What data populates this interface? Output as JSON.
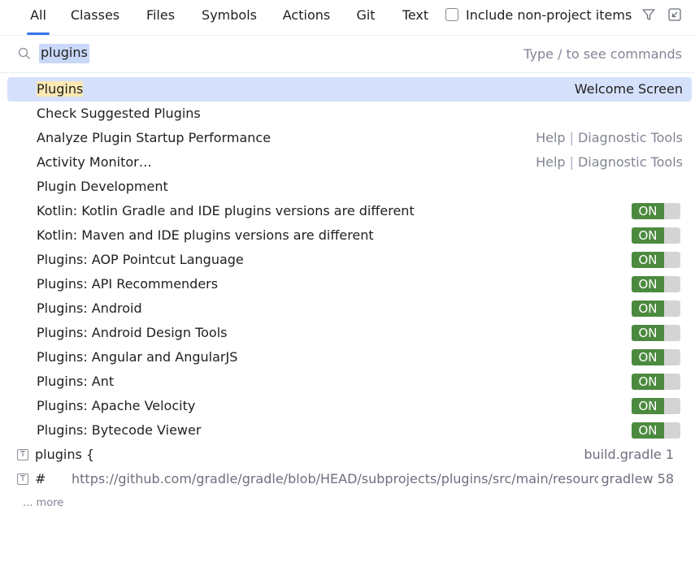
{
  "tabs": [
    {
      "label": "All",
      "active": true
    },
    {
      "label": "Classes"
    },
    {
      "label": "Files"
    },
    {
      "label": "Symbols"
    },
    {
      "label": "Actions"
    },
    {
      "label": "Git"
    },
    {
      "label": "Text"
    }
  ],
  "include_non_project": {
    "label": "Include non-project items",
    "checked": false
  },
  "header_icons": [
    "filter-icon",
    "collapse-to-panel-icon"
  ],
  "search": {
    "value": "plugins",
    "hint": "Type / to see commands"
  },
  "results": [
    {
      "pre": "",
      "hl": "Plugins",
      "post": "",
      "right": "Welcome Screen",
      "selected": true
    },
    {
      "pre": "Check Suggested Plugins"
    },
    {
      "pre": "Analyze Plugin Startup Performance",
      "right_a": "Help",
      "right_b": "Diagnostic Tools"
    },
    {
      "pre": "Activity Monitor…",
      "right_a": "Help",
      "right_b": "Diagnostic Tools"
    },
    {
      "pre": "Plugin Development"
    }
  ],
  "toggle_label": "ON",
  "toggle_results": [
    "Kotlin: Kotlin Gradle and IDE plugins versions are different",
    "Kotlin: Maven and IDE plugins versions are different",
    "Plugins: AOP Pointcut Language",
    "Plugins: API Recommenders",
    "Plugins: Android",
    "Plugins: Android Design Tools",
    "Plugins: Angular and AngularJS",
    "Plugins: Ant",
    "Plugins: Apache Velocity",
    "Plugins: Bytecode Viewer"
  ],
  "text_results": [
    {
      "icon": "T",
      "name": "plugins {",
      "url": "",
      "right": "build.gradle 1"
    },
    {
      "icon": "T",
      "name": "#",
      "url": "https://github.com/gradle/gradle/blob/HEAD/subprojects/plugins/src/main/resource",
      "right": "gradlew 58"
    }
  ],
  "more_label": "... more",
  "colors": {
    "accent": "#3574f0",
    "selection": "#d5e1fb",
    "highlight": "#fce9b3",
    "toggle_on": "#4c8a3f"
  }
}
